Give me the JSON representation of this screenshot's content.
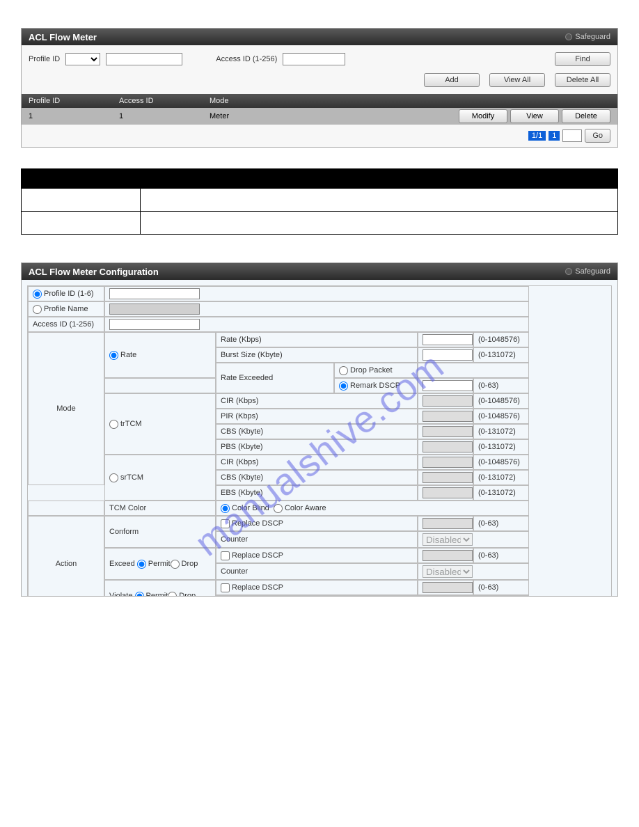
{
  "watermark": "manualshive.com",
  "panel1": {
    "title": "ACL Flow Meter",
    "safeguard": "Safeguard",
    "profileid_lbl": "Profile ID",
    "accessid_lbl": "Access ID (1-256)",
    "find": "Find",
    "add": "Add",
    "viewall": "View All",
    "deleteall": "Delete All",
    "h1": "Profile ID",
    "h2": "Access ID",
    "h3": "Mode",
    "row": {
      "pid": "1",
      "aid": "1",
      "mode": "Meter"
    },
    "modify": "Modify",
    "view": "View",
    "delete": "Delete",
    "pager": {
      "total": "1/1",
      "cur": "1",
      "go": "Go"
    }
  },
  "paramtable": {
    "emptyrows": 2
  },
  "panel2": {
    "title": "ACL Flow Meter Configuration",
    "safeguard": "Safeguard",
    "pid_lbl": "Profile ID (1-6)",
    "pname_lbl": "Profile Name",
    "aid_lbl": "Access ID (1-256)",
    "mode_lbl": "Mode",
    "action_lbl": "Action",
    "rate": "Rate",
    "tr": "trTCM",
    "sr": "srTCM",
    "tcmcolor": "TCM Color",
    "conform": "Conform",
    "exceed": "Exceed",
    "violate": "Violate",
    "permit": "Permit",
    "drop": "Drop",
    "rate_kbps": "Rate (Kbps)",
    "burst": "Burst Size (Kbyte)",
    "rate_ex": "Rate Exceeded",
    "drop_pkt": "Drop Packet",
    "remark_dscp": "Remark DSCP",
    "cir": "CIR (Kbps)",
    "pir": "PIR (Kbps)",
    "cbs": "CBS (Kbyte)",
    "pbs": "PBS (Kbyte)",
    "ebs": "EBS (Kbyte)",
    "blind": "Color Blind",
    "aware": "Color Aware",
    "replace_dscp": "Replace DSCP",
    "counter": "Counter",
    "disabled": "Disabled",
    "r_1048576": "(0-1048576)",
    "r_131072": "(0-131072)",
    "r_63": "(0-63)"
  }
}
